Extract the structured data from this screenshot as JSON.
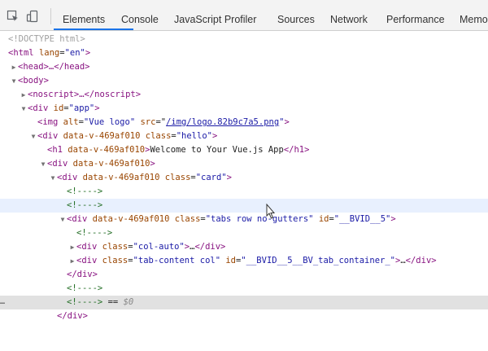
{
  "toolbar": {
    "tabs": [
      {
        "label": "Elements",
        "active": true
      },
      {
        "label": "Console"
      },
      {
        "label": "JavaScript Profiler"
      },
      {
        "label": "Sources"
      },
      {
        "label": "Network"
      },
      {
        "label": "Performance"
      },
      {
        "label": "Memo"
      }
    ],
    "icons": [
      "select-element-icon",
      "device-toolbar-icon"
    ],
    "accent_color": "#1a73e8"
  },
  "tree": {
    "doctype": "<!DOCTYPE html>",
    "html_open": "<html",
    "html_lang_attr": "lang",
    "html_lang_val": "\"en\"",
    "head": "<head>…</head>",
    "body_open": "<body>",
    "noscript": "<noscript>…</noscript>",
    "app_div_tag": "<div",
    "app_div_attr": "id",
    "app_div_val": "\"app\"",
    "img_tag": "<img",
    "img_alt_attr": "alt",
    "img_alt_val": "\"Vue logo\"",
    "img_src_attr": "src",
    "img_src_val": "/img/logo.82b9c7a5.png",
    "data_v_attr": "data-v-469af010",
    "class_attr": "class",
    "hello_val": "\"hello\"",
    "h1_tag": "<h1",
    "h1_text": "Welcome to Your Vue.js App",
    "h1_close": "</h1>",
    "div_close": "</div>",
    "card_val": "\"card\"",
    "comment": "<!---->",
    "tabs_class_val": "\"tabs row no-gutters\"",
    "id_attr": "id",
    "tabs_id_val": "\"__BVID__5\"",
    "col_auto_val": "\"col-auto\"",
    "ellipsis": "…",
    "tab_content_val": "\"tab-content col\"",
    "tab_content_id_val": "\"__BVID__5__BV_tab_container_\"",
    "selected_suffix": " == ",
    "selected_ref": "$0",
    "gutter": "…"
  }
}
